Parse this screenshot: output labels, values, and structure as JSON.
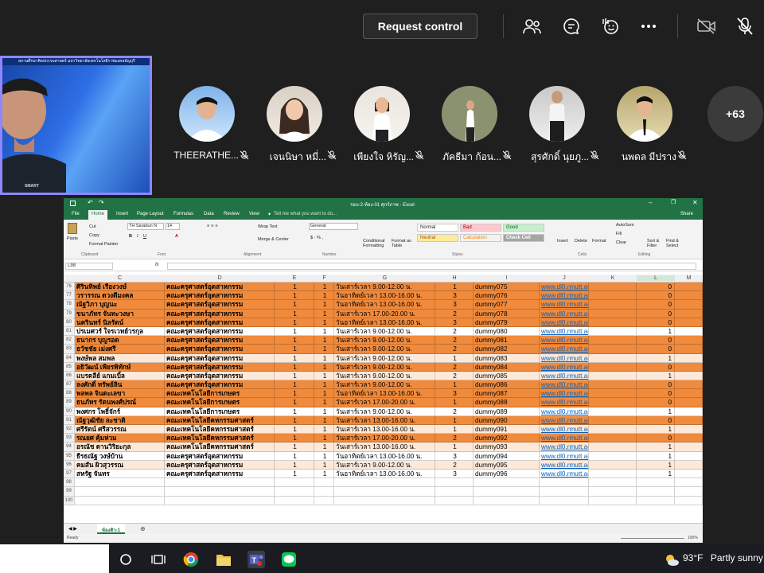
{
  "meeting": {
    "request_control_label": "Request control",
    "more_participants": "+63"
  },
  "self_video": {
    "banner_text": "สถานศึกษาศิลปกรรมศาสตร์ มหาวิทยาลัยเทคโนโลยีราชมงคลธัญบุรี",
    "shirt_text": "SMART"
  },
  "participants": [
    {
      "name": "THEERATHE..."
    },
    {
      "name": "เจนนิษา หมี่..."
    },
    {
      "name": "เพียงใจ หิรัญ..."
    },
    {
      "name": "ภัคธีมา ก้อน..."
    },
    {
      "name": "สุรศักดิ์ นุยภู..."
    },
    {
      "name": "นพดล มีปราง"
    }
  ],
  "excel": {
    "title": "รอบ-2-ห้อง-01 ศุกร์ภาพ - Excel",
    "share_label": "Share",
    "tabs": [
      "File",
      "Home",
      "Insert",
      "Page Layout",
      "Formulas",
      "Data",
      "Review",
      "View"
    ],
    "tell_me": "Tell me what you want to do...",
    "ribbon": {
      "paste": "Paste",
      "cut": "Cut",
      "copy": "Copy",
      "format_painter": "Format Painter",
      "font_name": "TH Sarabun N",
      "font_size": "14",
      "wrap_text": "Wrap Text",
      "merge_center": "Merge & Center",
      "number_format": "General",
      "conditional_formatting": "Conditional Formatting",
      "format_as_table": "Format as Table",
      "styles": {
        "normal": "Normal",
        "bad": "Bad",
        "good": "Good",
        "neutral": "Neutral",
        "calculation": "Calculation",
        "check_cell": "Check Cell"
      },
      "insert": "Insert",
      "delete": "Delete",
      "format": "Format",
      "autosum": "AutoSum",
      "fill": "Fill",
      "clear": "Clear",
      "sort_filter": "Sort & Filter",
      "find_select": "Find & Select",
      "groups": [
        "Clipboard",
        "Font",
        "Alignment",
        "Number",
        "Styles",
        "Cells",
        "Editing"
      ]
    },
    "name_box": "L98",
    "columns": [
      "C",
      "D",
      "E",
      "F",
      "G",
      "H",
      "I",
      "J",
      "K",
      "L",
      "M"
    ],
    "rows": [
      {
        "n": "76",
        "c": "ศิรินทิพย์ เรืองวงษ์",
        "d": "คณะครุศาสตร์อุตสาหกรรม",
        "e": "1",
        "f": "1",
        "g": "วันเสาร์เวลา 9.00-12.00 น.",
        "h": "1",
        "i": "dummy075",
        "j": "www.dl0.rmutt.ac.th",
        "l": "0",
        "style": "orange"
      },
      {
        "n": "77",
        "c": "วรารรณ ดวงดีมงคล",
        "d": "คณะครุศาสตร์อุตสาหกรรม",
        "e": "1",
        "f": "1",
        "g": "วันอาทิตย์เวลา 13.00-16.00 น.",
        "h": "3",
        "i": "dummy076",
        "j": "www.dl0.rmutt.ac.th",
        "l": "0",
        "style": "orange"
      },
      {
        "n": "78",
        "c": "ณัฐวิภา บุญนะ",
        "d": "คณะครุศาสตร์อุตสาหกรรม",
        "e": "1",
        "f": "1",
        "g": "วันอาทิตย์เวลา 13.00-16.00 น.",
        "h": "3",
        "i": "dummy077",
        "j": "www.dl0.rmutt.ac.th",
        "l": "0",
        "style": "orange"
      },
      {
        "n": "79",
        "c": "ขนาภัทร จันทะวงษา",
        "d": "คณะครุศาสตร์อุตสาหกรรม",
        "e": "1",
        "f": "1",
        "g": "วันเสาร์เวลา 17.00-20.00 น.",
        "h": "2",
        "i": "dummy078",
        "j": "www.dl0.rmutt.ac.th",
        "l": "0",
        "style": "orange"
      },
      {
        "n": "80",
        "c": "นครินทร์ นิลรัตน์",
        "d": "คณะครุศาสตร์อุตสาหกรรม",
        "e": "1",
        "f": "1",
        "g": "วันอาทิตย์เวลา 13.00-16.00 น.",
        "h": "3",
        "i": "dummy079",
        "j": "www.dl0.rmutt.ac.th",
        "l": "0",
        "style": "orange"
      },
      {
        "n": "81",
        "c": "ปรเมศวร์ ใจรเวทย์วรกุล",
        "d": "คณะครุศาสตร์อุตสาหกรรม",
        "e": "1",
        "f": "1",
        "g": "วันเสาร์เวลา 9.00-12.00 น.",
        "h": "2",
        "i": "dummy080",
        "j": "www.dl0.rmutt.ac.th",
        "l": "1",
        "style": "white"
      },
      {
        "n": "82",
        "c": "ธนากร บุญรอด",
        "d": "คณะครุศาสตร์อุตสาหกรรม",
        "e": "1",
        "f": "1",
        "g": "วันเสาร์เวลา 9.00-12.00 น.",
        "h": "2",
        "i": "dummy081",
        "j": "www.dl0.rmutt.ac.th",
        "l": "0",
        "style": "orange"
      },
      {
        "n": "83",
        "c": "ธวัชชัย เม่งศรี",
        "d": "คณะครุศาสตร์อุตสาหกรรม",
        "e": "1",
        "f": "1",
        "g": "วันเสาร์เวลา 9.00-12.00 น.",
        "h": "2",
        "i": "dummy082",
        "j": "www.dl0.rmutt.ac.th",
        "l": "0",
        "style": "orange"
      },
      {
        "n": "84",
        "c": "พงษ์พล สมพล",
        "d": "คณะครุศาสตร์อุตสาหกรรม",
        "e": "1",
        "f": "1",
        "g": "วันเสาร์เวลา 9.00-12.00 น.",
        "h": "1",
        "i": "dummy083",
        "j": "www.dl0.rmutt.ac.th",
        "l": "1",
        "style": "light"
      },
      {
        "n": "85",
        "c": "อธิวัฒน์ เพียรพิทักษ์",
        "d": "คณะครุศาสตร์อุตสาหกรรม",
        "e": "1",
        "f": "1",
        "g": "วันเสาร์เวลา 9.00-12.00 น.",
        "h": "2",
        "i": "dummy084",
        "j": "www.dl0.rmutt.ac.th",
        "l": "0",
        "style": "orange"
      },
      {
        "n": "86",
        "c": "แบรดลีย์ แกมเบิ้ล",
        "d": "คณะครุศาสตร์อุตสาหกรรม",
        "e": "1",
        "f": "1",
        "g": "วันเสาร์เวลา 9.00-12.00 น.",
        "h": "2",
        "i": "dummy085",
        "j": "www.dl0.rmutt.ac.th",
        "l": "1",
        "style": "light"
      },
      {
        "n": "87",
        "c": "ลงศักดิ์ ทรัพย์ลิน",
        "d": "คณะครุศาสตร์อุตสาหกรรม",
        "e": "1",
        "f": "1",
        "g": "วันเสาร์เวลา 9.00-12.00 น.",
        "h": "1",
        "i": "dummy086",
        "j": "www.dl0.rmutt.ac.th",
        "l": "0",
        "style": "orange"
      },
      {
        "n": "88",
        "c": "พลพล จินดะเลขา",
        "d": "คณะเทคโนโลยีการเกษตร",
        "e": "1",
        "f": "1",
        "g": "วันอาทิตย์เวลา 13.00-16.00 น.",
        "h": "3",
        "i": "dummy087",
        "j": "www.dl0.rmutt.ac.th",
        "l": "0",
        "style": "orange"
      },
      {
        "n": "89",
        "c": "ธนภัทร รัตนพงศ์ปรณ์",
        "d": "คณะเทคโนโลยีการเกษตร",
        "e": "1",
        "f": "1",
        "g": "วันเสาร์เวลา 17.00-20.00 น.",
        "h": "1",
        "i": "dummy088",
        "j": "www.dl0.rmutt.ac.th",
        "l": "0",
        "style": "orange"
      },
      {
        "n": "90",
        "c": "พงศกร โพธิ์จักร์",
        "d": "คณะเทคโนโลยีการเกษตร",
        "e": "1",
        "f": "1",
        "g": "วันเสาร์เวลา 9.00-12.00 น.",
        "h": "2",
        "i": "dummy089",
        "j": "www.dl0.rmutt.ac.th",
        "l": "1",
        "style": "white"
      },
      {
        "n": "91",
        "c": "ณัฐวุฒิชัย ละชาติ",
        "d": "คณะเทคโนโลยีคหกรรมศาสตร์",
        "e": "1",
        "f": "1",
        "g": "วันเสาร์เวลา 13.00-16.00 น.",
        "h": "1",
        "i": "dummy090",
        "j": "www.dl0.rmutt.ac.th",
        "l": "0",
        "style": "orange"
      },
      {
        "n": "92",
        "c": "ศรีรัตน์ ศรีสวรรณ",
        "d": "คณะเทคโนโลยีคหกรรมศาสตร์",
        "e": "1",
        "f": "1",
        "g": "วันเสาร์เวลา 13.00-16.00 น.",
        "h": "1",
        "i": "dummy091",
        "j": "www.dl0.rmutt.ac.th",
        "l": "1",
        "style": "light"
      },
      {
        "n": "93",
        "c": "รณยศ คุ้มห่วม",
        "d": "คณะเทคโนโลยีคหกรรมศาสตร์",
        "e": "1",
        "f": "1",
        "g": "วันเสาร์เวลา 17.00-20.00 น.",
        "h": "2",
        "i": "dummy092",
        "j": "www.dl0.rmutt.ac.th",
        "l": "0",
        "style": "orange"
      },
      {
        "n": "94",
        "c": "อรณัช ดานวิริยะกุล",
        "d": "คณะเทคโนโลยีคหกรรมศาสตร์",
        "e": "1",
        "f": "1",
        "g": "วันเสาร์เวลา 13.00-16.00 น.",
        "h": "1",
        "i": "dummy093",
        "j": "www.dl0.rmutt.ac.th",
        "l": "1",
        "style": "light"
      },
      {
        "n": "95",
        "c": "ธีรธณัฐ วงษ์บ้าน",
        "d": "คณะครุศาสตร์อุตสาหกรรม",
        "e": "1",
        "f": "1",
        "g": "วันอาทิตย์เวลา 13.00-16.00 น.",
        "h": "3",
        "i": "dummy094",
        "j": "www.dl0.rmutt.ac.th",
        "l": "1",
        "style": "white"
      },
      {
        "n": "96",
        "c": "คมสัน ผิวสุวรรณ",
        "d": "คณะครุศาสตร์อุตสาหกรรม",
        "e": "1",
        "f": "1",
        "g": "วันเสาร์เวลา 9.00-12.00 น.",
        "h": "2",
        "i": "dummy095",
        "j": "www.dl0.rmutt.ac.th",
        "l": "1",
        "style": "light"
      },
      {
        "n": "97",
        "c": "สหรัฐ จันทร",
        "d": "คณะครุศาสตร์อุตสาหกรรม",
        "e": "1",
        "f": "1",
        "g": "วันอาทิตย์เวลา 13.00-16.00 น.",
        "h": "3",
        "i": "dummy096",
        "j": "www.dl0.rmutt.ac.th",
        "l": "1",
        "style": "white"
      },
      {
        "n": "98",
        "c": "",
        "d": "",
        "e": "",
        "f": "",
        "g": "",
        "h": "",
        "i": "",
        "j": "",
        "l": "",
        "style": "white"
      },
      {
        "n": "99",
        "c": "",
        "d": "",
        "e": "",
        "f": "",
        "g": "",
        "h": "",
        "i": "",
        "j": "",
        "l": "",
        "style": "white"
      },
      {
        "n": "100",
        "c": "",
        "d": "",
        "e": "",
        "f": "",
        "g": "",
        "h": "",
        "i": "",
        "j": "",
        "l": "",
        "style": "white"
      }
    ],
    "sheet_tab": "ห้องติว-1",
    "status": "Ready",
    "zoom": "100%"
  },
  "weather": {
    "temp": "93°F",
    "desc": "Partly sunny"
  }
}
